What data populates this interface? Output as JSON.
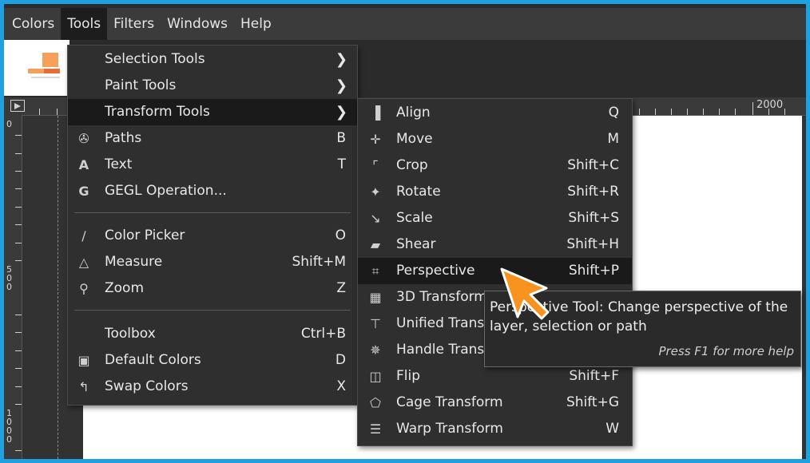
{
  "menubar": {
    "items": [
      {
        "label": "Colors"
      },
      {
        "label": "Tools"
      },
      {
        "label": "Filters"
      },
      {
        "label": "Windows"
      },
      {
        "label": "Help"
      }
    ]
  },
  "ruler": {
    "h_number": "2000",
    "v_numbers": [
      "0",
      "500",
      "1000"
    ]
  },
  "tools_menu": {
    "items": [
      {
        "label": "Selection Tools",
        "icon": "none",
        "submenu": true
      },
      {
        "label": "Paint Tools",
        "icon": "none",
        "submenu": true
      },
      {
        "label": "Transform Tools",
        "icon": "none",
        "submenu": true
      },
      {
        "label": "Paths",
        "icon": "paths-icon",
        "accel": "B"
      },
      {
        "label": "Text",
        "icon": "text-icon",
        "accel": "T"
      },
      {
        "label": "GEGL Operation...",
        "icon": "gegl-icon"
      },
      {
        "label": "Color Picker",
        "icon": "color-picker-icon",
        "accel": "O"
      },
      {
        "label": "Measure",
        "icon": "measure-icon",
        "accel": "Shift+M"
      },
      {
        "label": "Zoom",
        "icon": "zoom-icon",
        "accel": "Z"
      },
      {
        "label": "Toolbox",
        "icon": "none",
        "accel": "Ctrl+B"
      },
      {
        "label": "Default Colors",
        "icon": "default-colors-icon",
        "accel": "D"
      },
      {
        "label": "Swap Colors",
        "icon": "swap-colors-icon",
        "accel": "X"
      }
    ]
  },
  "transform_menu": {
    "items": [
      {
        "label": "Align",
        "icon": "align-icon",
        "accel": "Q"
      },
      {
        "label": "Move",
        "icon": "move-icon",
        "accel": "M"
      },
      {
        "label": "Crop",
        "icon": "crop-icon",
        "accel": "Shift+C"
      },
      {
        "label": "Rotate",
        "icon": "rotate-icon",
        "accel": "Shift+R"
      },
      {
        "label": "Scale",
        "icon": "scale-icon",
        "accel": "Shift+S"
      },
      {
        "label": "Shear",
        "icon": "shear-icon",
        "accel": "Shift+H"
      },
      {
        "label": "Perspective",
        "icon": "perspective-icon",
        "accel": "Shift+P"
      },
      {
        "label": "3D Transform",
        "icon": "3d-transform-icon",
        "accel": ""
      },
      {
        "label": "Unified Transform",
        "icon": "unified-transform-icon",
        "accel": ""
      },
      {
        "label": "Handle Transform",
        "icon": "handle-transform-icon",
        "accel": ""
      },
      {
        "label": "Flip",
        "icon": "flip-icon",
        "accel": "Shift+F"
      },
      {
        "label": "Cage Transform",
        "icon": "cage-transform-icon",
        "accel": "Shift+G"
      },
      {
        "label": "Warp Transform",
        "icon": "warp-transform-icon",
        "accel": "W"
      }
    ]
  },
  "tooltip": {
    "text": "Perspective Tool: Change perspective of the layer, selection or path",
    "help": "Press F1 for more help"
  },
  "colors": {
    "accent_border": "#1da1e2",
    "cursor": "#f7931e",
    "menu_bg": "#2f2f2f"
  }
}
